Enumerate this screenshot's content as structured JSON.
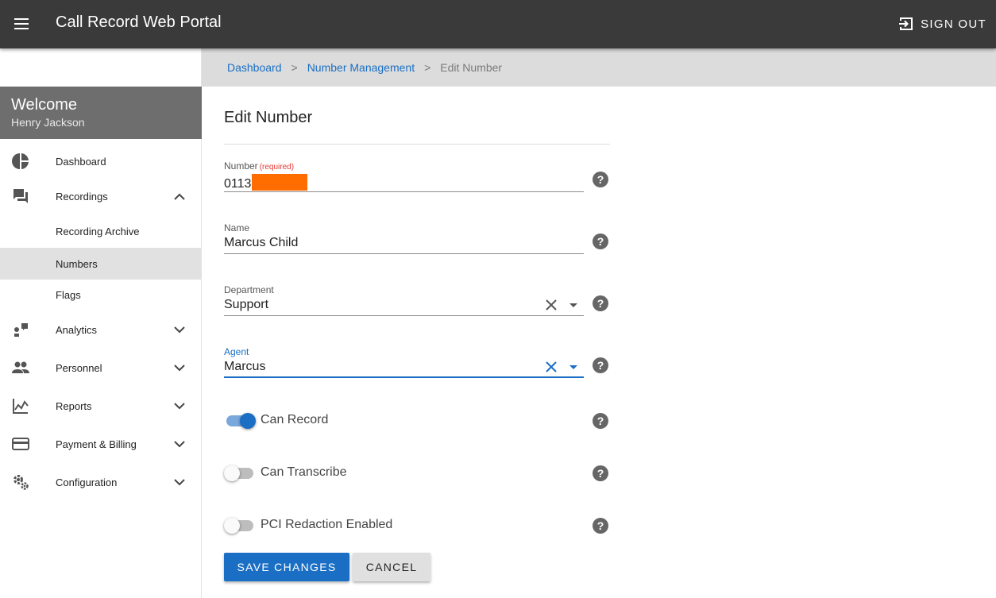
{
  "app": {
    "title": "Call Record Web Portal",
    "signout_label": "SIGN OUT"
  },
  "sidebar": {
    "welcome_title": "Welcome",
    "user_name": "Henry Jackson",
    "items": [
      {
        "label": "Dashboard",
        "icon": "pie-chart-icon"
      },
      {
        "label": "Recordings",
        "icon": "chat-icon",
        "expanded": true
      },
      {
        "label": "Recording Archive"
      },
      {
        "label": "Numbers",
        "active": true
      },
      {
        "label": "Flags"
      },
      {
        "label": "Analytics",
        "icon": "analytics-icon"
      },
      {
        "label": "Personnel",
        "icon": "people-icon"
      },
      {
        "label": "Reports",
        "icon": "reports-icon"
      },
      {
        "label": "Payment & Billing",
        "icon": "credit-card-icon"
      },
      {
        "label": "Configuration",
        "icon": "gears-icon"
      }
    ]
  },
  "breadcrumb": {
    "items": [
      "Dashboard",
      "Number Management"
    ],
    "separator": ">",
    "current": "Edit Number"
  },
  "form": {
    "title": "Edit Number",
    "number": {
      "label": "Number",
      "required_label": "(required)",
      "value": "0113"
    },
    "name": {
      "label": "Name",
      "value": "Marcus Child"
    },
    "department": {
      "label": "Department",
      "value": "Support"
    },
    "agent": {
      "label": "Agent",
      "value": "Marcus"
    },
    "toggles": [
      {
        "label": "Can Record",
        "on": true
      },
      {
        "label": "Can Transcribe",
        "on": false
      },
      {
        "label": "PCI Redaction Enabled",
        "on": false
      }
    ],
    "help_symbol": "?",
    "save_label": "SAVE CHANGES",
    "cancel_label": "CANCEL"
  },
  "colors": {
    "accent": "#1a6fc4",
    "topbar": "#3a3a3a",
    "redaction": "#ff6d00"
  }
}
